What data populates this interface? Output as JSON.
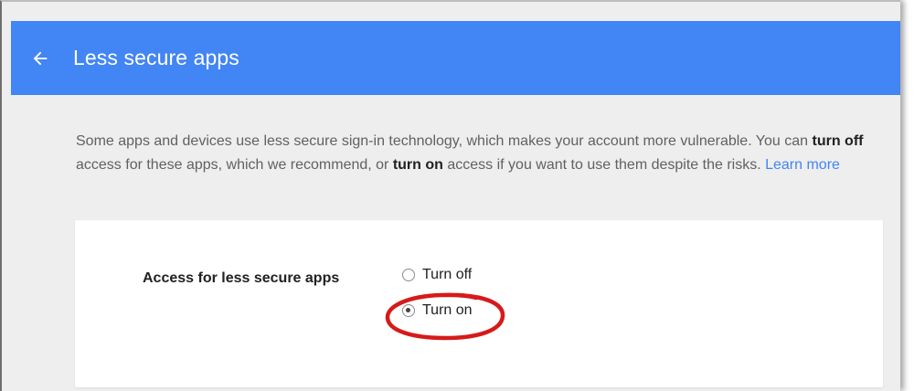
{
  "header": {
    "title": "Less secure apps",
    "back_icon": "arrow-back-icon",
    "background_color": "#4285f4"
  },
  "description": {
    "part1": "Some apps and devices use less secure sign-in technology, which makes your account more vulnerable. You can ",
    "bold1": "turn off",
    "part2": " access for these apps, which we recommend, or ",
    "bold2": "turn on",
    "part3": " access if you want to use them despite the risks. ",
    "link": "Learn more",
    "link_color": "#4285f4"
  },
  "setting": {
    "label": "Access for less secure apps",
    "options": [
      {
        "label": "Turn off",
        "checked": false
      },
      {
        "label": "Turn on",
        "checked": true
      }
    ]
  },
  "annotation": {
    "shape": "ellipse",
    "color": "#d61a1a"
  }
}
